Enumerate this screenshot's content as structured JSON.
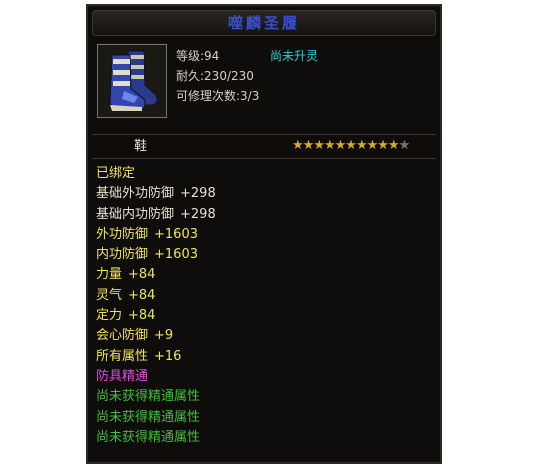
{
  "item": {
    "name": "噬麟圣履",
    "level": "等级:94",
    "spirit_status": "尚未升灵",
    "durability": "耐久:230/230",
    "repair": "可修理次数:3/3",
    "type": "鞋",
    "stars_filled": 10,
    "stars_total": 11,
    "icon": "boot-icon"
  },
  "attributes": [
    {
      "name": "已绑定",
      "value": "",
      "style": "bound"
    },
    {
      "name": "基础外功防御",
      "value": "+298",
      "style": "white"
    },
    {
      "name": "基础内功防御",
      "value": "+298",
      "style": "white"
    },
    {
      "name": "外功防御",
      "value": "+1603",
      "style": "yellow"
    },
    {
      "name": "内功防御",
      "value": "+1603",
      "style": "yellow"
    },
    {
      "name": "力量",
      "value": "+84",
      "style": "yellow"
    },
    {
      "name": "灵气",
      "value": "+84",
      "style": "yellow"
    },
    {
      "name": "定力",
      "value": "+84",
      "style": "yellow"
    },
    {
      "name": "会心防御",
      "value": "+9",
      "style": "yellow"
    },
    {
      "name": "所有属性",
      "value": "+16",
      "style": "yellow"
    },
    {
      "name": "防具精通",
      "value": "",
      "style": "magenta"
    },
    {
      "name": "尚未获得精通属性",
      "value": "",
      "style": "green"
    },
    {
      "name": "尚未获得精通属性",
      "value": "",
      "style": "green"
    },
    {
      "name": "尚未获得精通属性",
      "value": "",
      "style": "green"
    }
  ],
  "colors": {
    "title": "#3a4fd0",
    "spirit": "#29d0d0",
    "yellow": "#f0e35a",
    "magenta": "#e44ad9",
    "green": "#3fbe3a",
    "star": "#d8a727"
  }
}
